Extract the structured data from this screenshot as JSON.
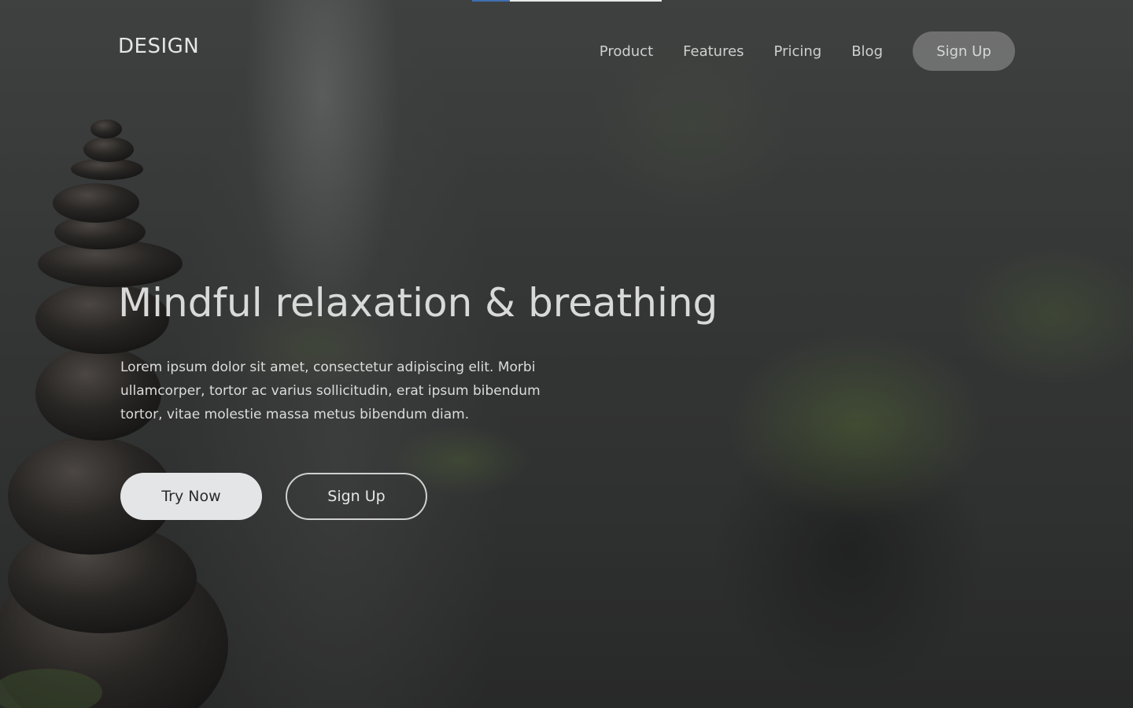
{
  "header": {
    "logo": "DESIGN",
    "nav": {
      "product": "Product",
      "features": "Features",
      "pricing": "Pricing",
      "blog": "Blog",
      "signup": "Sign Up"
    }
  },
  "progress": {
    "value": 0.2
  },
  "hero": {
    "title": "Mindful relaxation & breathing",
    "text": "Lorem ipsum dolor sit amet, consectetur adipiscing elit. Morbi ullamcorper, tortor ac varius sollicitudin, erat ipsum bibendum tortor, vitae molestie massa metus bibendum diam.",
    "try_now": "Try Now",
    "sign_up": "Sign Up"
  },
  "colors": {
    "progress_fill": "#3f6fb0",
    "primary_button": "#e4e5e7"
  }
}
